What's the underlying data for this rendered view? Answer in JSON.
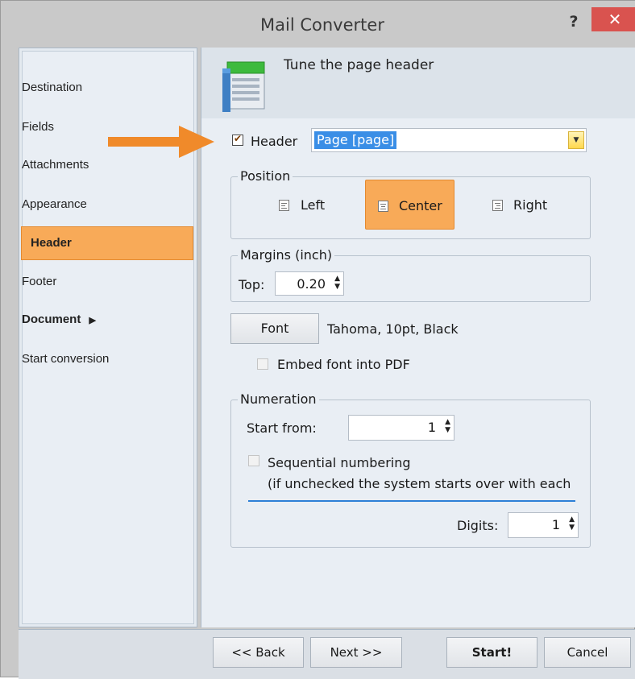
{
  "window": {
    "title": "Mail Converter",
    "help_label": "?",
    "close_label": "✕",
    "accent_color": "#f8aa58",
    "close_color": "#d9534f"
  },
  "sidebar": {
    "items": [
      {
        "label": "Destination"
      },
      {
        "label": "Fields"
      },
      {
        "label": "Attachments"
      },
      {
        "label": "Appearance"
      },
      {
        "label": "Header",
        "active": true
      },
      {
        "label": "Footer"
      },
      {
        "label": "Document",
        "has_submenu": true
      },
      {
        "label": "Start conversion"
      }
    ],
    "submenu_arrow": "▶"
  },
  "main": {
    "title": "Tune the page header",
    "header_checkbox": {
      "label": "Header",
      "checked": true
    },
    "header_value": "Page [page]",
    "position": {
      "title": "Position",
      "options": [
        "Left",
        "Center",
        "Right"
      ],
      "selected": "Center"
    },
    "margins": {
      "title": "Margins (inch)",
      "top_label": "Top:",
      "top_value": "0.20"
    },
    "font": {
      "button_label": "Font",
      "description": "Tahoma, 10pt, Black"
    },
    "embed_font": {
      "label": "Embed font into PDF",
      "checked": false
    },
    "numeration": {
      "title": "Numeration",
      "start_label": "Start from:",
      "start_value": "1",
      "sequential_label": "Sequential numbering",
      "sequential_note": "(if unchecked the system starts over with each",
      "sequential_checked": false,
      "digits_label": "Digits:",
      "digits_value": "1"
    }
  },
  "footer": {
    "back_label": "<< Back",
    "next_label": "Next >>",
    "start_label": "Start!",
    "cancel_label": "Cancel"
  }
}
